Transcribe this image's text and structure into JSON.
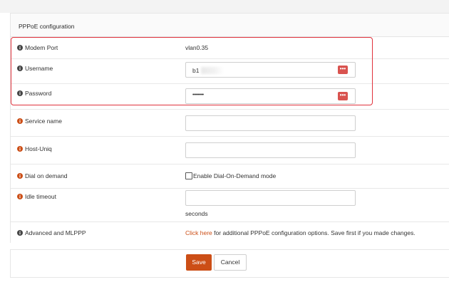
{
  "section": {
    "title": "PPPoE configuration"
  },
  "fields": {
    "modem_port": {
      "label": "Modem Port",
      "value": "vlan0.35"
    },
    "username": {
      "label": "Username",
      "value": "b1"
    },
    "password": {
      "label": "Password",
      "value": "••••••••"
    },
    "service_name": {
      "label": "Service name",
      "value": ""
    },
    "host_uniq": {
      "label": "Host-Uniq",
      "value": ""
    },
    "dial_on_demand": {
      "label": "Dial on demand",
      "checkbox_label": "Enable Dial-On-Demand mode",
      "checked": false
    },
    "idle_timeout": {
      "label": "Idle timeout",
      "value": "",
      "unit": "seconds"
    },
    "advanced": {
      "label": "Advanced and MLPPP",
      "link_text": "Click here",
      "rest_text": " for additional PPPoE configuration options. Save first if you made changes."
    }
  },
  "buttons": {
    "save": "Save",
    "cancel": "Cancel",
    "reveal_glyph": "•••"
  },
  "colors": {
    "accent": "#cc4e16",
    "highlight": "#e0323c",
    "reveal": "#d9534f"
  },
  "icons": {
    "info": "info-circle-icon",
    "reveal": "password-reveal-icon"
  }
}
